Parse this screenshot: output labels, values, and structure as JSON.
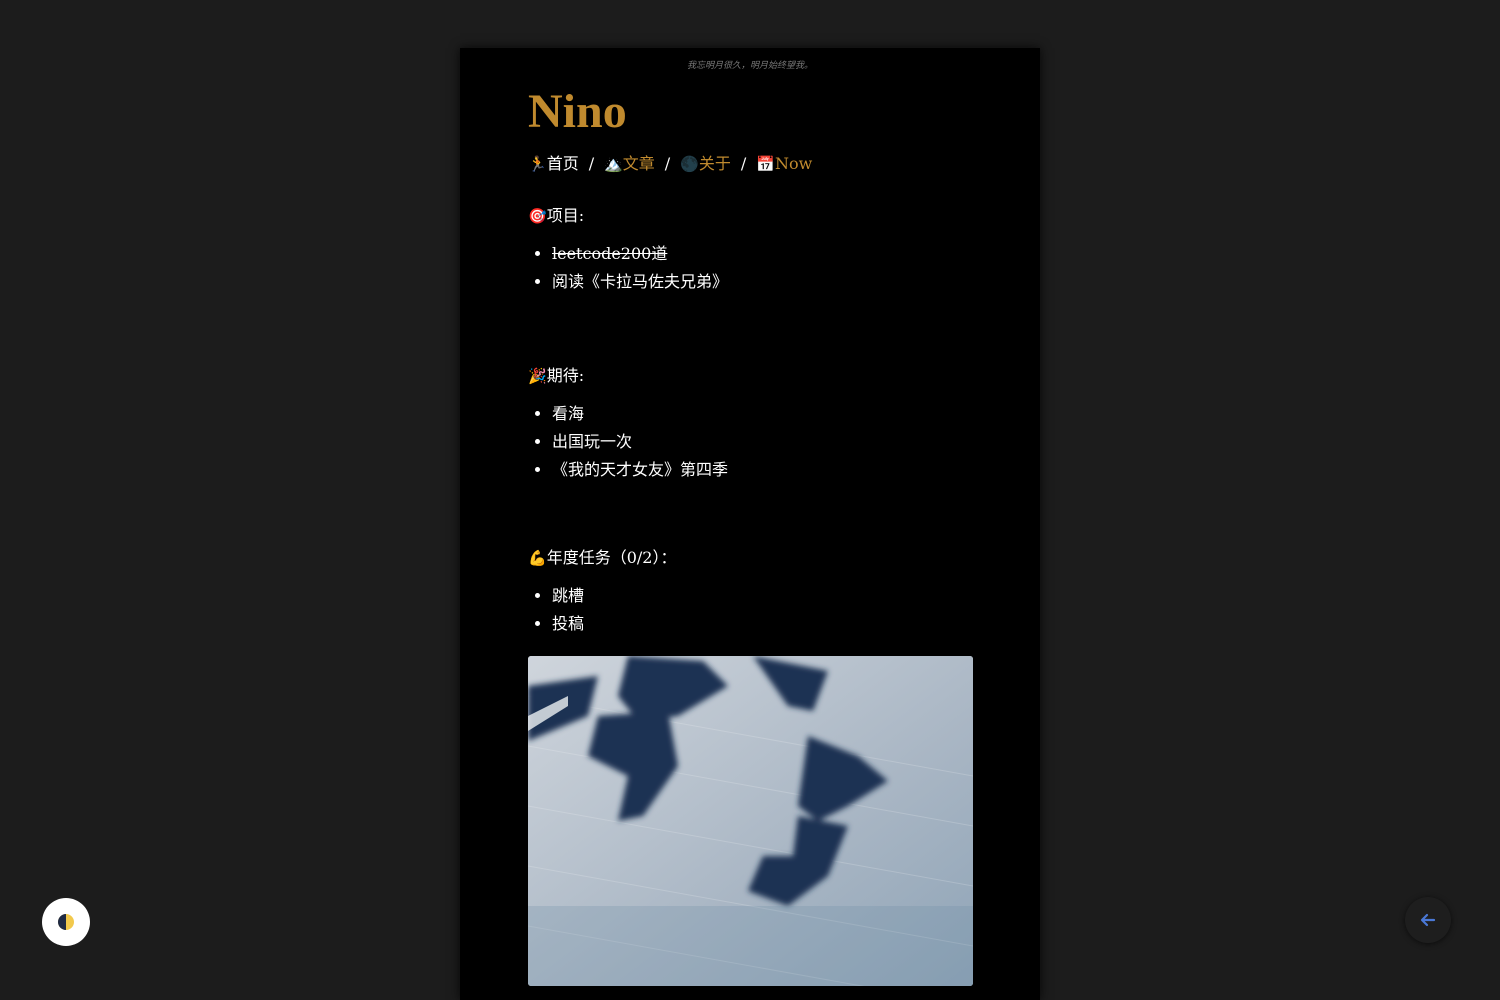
{
  "header": {
    "tagline": "我忘明月很久，明月始终望我。",
    "site_title": "Nino"
  },
  "nav": {
    "items": [
      {
        "icon": "🏃",
        "label": "首页"
      },
      {
        "icon": "🏔️",
        "label": "文章"
      },
      {
        "icon": "🌑",
        "label": "关于"
      },
      {
        "icon": "📅",
        "label": "Now"
      }
    ],
    "separator": "/"
  },
  "sections": [
    {
      "icon": "🎯",
      "heading": "项目:",
      "items": [
        "leetcode200道",
        "阅读《卡拉马佐夫兄弟》"
      ]
    },
    {
      "icon": "🎉",
      "heading": "期待:",
      "items": [
        "看海",
        "出国玩一次",
        "《我的天才女友》第四季"
      ]
    },
    {
      "icon": "💪",
      "heading": "年度任务（0/2）：",
      "items": [
        "跳槽",
        "投稿"
      ]
    }
  ],
  "colors": {
    "background": "#1c1c1c",
    "page": "#000000",
    "accent": "#c08a2e",
    "text": "#ffffff",
    "back_arrow": "#4a78d6"
  },
  "icons": {
    "theme_toggle": "half-moon-icon",
    "back_button": "arrow-left-icon"
  }
}
